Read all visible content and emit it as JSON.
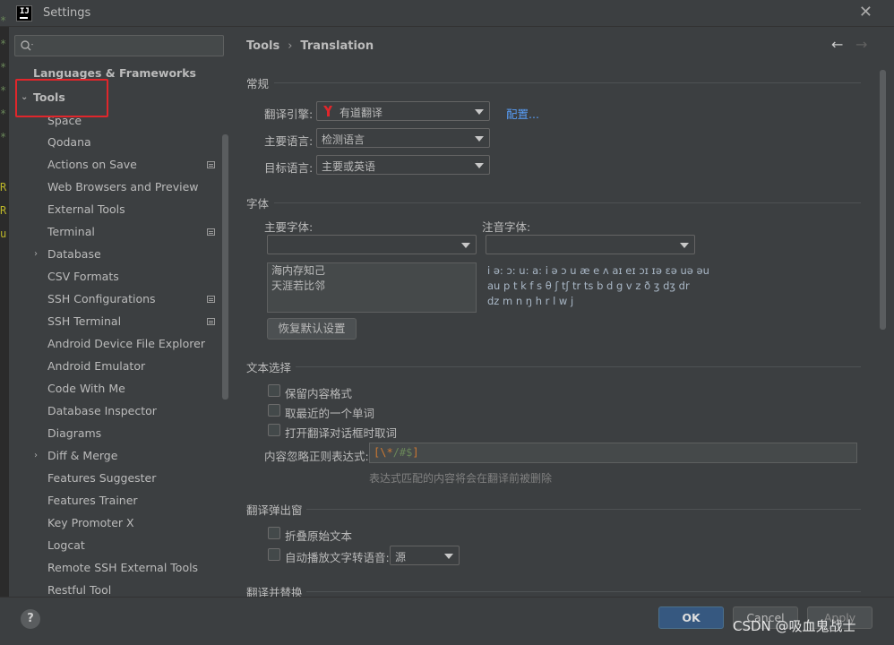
{
  "window": {
    "title": "Settings",
    "app_icon_text": "IJ"
  },
  "sidebar": {
    "search_placeholder": "",
    "items": [
      {
        "label": "Languages & Frameworks",
        "level": 0,
        "bold": true
      },
      {
        "label": "Tools",
        "level": 0,
        "bold": true,
        "expanded": true
      },
      {
        "label": "Space",
        "level": 1
      },
      {
        "label": "Qodana",
        "level": 1
      },
      {
        "label": "Actions on Save",
        "level": 1,
        "icon": true
      },
      {
        "label": "Web Browsers and Preview",
        "level": 1
      },
      {
        "label": "External Tools",
        "level": 1
      },
      {
        "label": "Terminal",
        "level": 1,
        "icon": true
      },
      {
        "label": "Database",
        "level": 1,
        "collapsed": true
      },
      {
        "label": "CSV Formats",
        "level": 1
      },
      {
        "label": "SSH Configurations",
        "level": 1,
        "icon": true
      },
      {
        "label": "SSH Terminal",
        "level": 1,
        "icon": true
      },
      {
        "label": "Android Device File Explorer",
        "level": 1
      },
      {
        "label": "Android Emulator",
        "level": 1
      },
      {
        "label": "Code With Me",
        "level": 1
      },
      {
        "label": "Database Inspector",
        "level": 1
      },
      {
        "label": "Diagrams",
        "level": 1
      },
      {
        "label": "Diff & Merge",
        "level": 1,
        "collapsed": true
      },
      {
        "label": "Features Suggester",
        "level": 1
      },
      {
        "label": "Features Trainer",
        "level": 1
      },
      {
        "label": "Key Promoter X",
        "level": 1
      },
      {
        "label": "Logcat",
        "level": 1
      },
      {
        "label": "Remote SSH External Tools",
        "level": 1
      },
      {
        "label": "Restful Tool",
        "level": 1
      }
    ]
  },
  "breadcrumb": {
    "parent": "Tools",
    "sep": "›",
    "current": "Translation"
  },
  "general": {
    "title": "常规",
    "engine_label": "翻译引擎:",
    "engine_value": "有道翻译",
    "configure_link": "配置...",
    "primary_lang_label": "主要语言:",
    "primary_lang_value": "检测语言",
    "target_lang_label": "目标语言:",
    "target_lang_value": "主要或英语"
  },
  "font": {
    "title": "字体",
    "primary_font_label": "主要字体:",
    "primary_font_value": "",
    "phonetic_font_label": "注音字体:",
    "phonetic_font_value": "",
    "preview_line1": "海内存知己",
    "preview_line2": "天涯若比邻",
    "phonetic_line1": "i ə: ɔ: u: a: i ə ɔ u æ e ʌ aɪ eɪ ɔɪ ɪə ɛə uə əu",
    "phonetic_line2": "au p t k f s θ ʃ tʃ tr ts b d g v z ð ʒ dʒ dr",
    "phonetic_line3": "dz m n ŋ h r l w j",
    "reset_button": "恢复默认设置"
  },
  "selection": {
    "title": "文本选择",
    "keep_format": "保留内容格式",
    "nearest_word": "取最近的一个单词",
    "cancel_on_open": "打开翻译对话框时取词",
    "regex_label": "内容忽略正则表达式:",
    "regex_bracket_open": "[",
    "regex_escape": "\\*",
    "regex_rest": "/#$",
    "regex_bracket_close": "]",
    "regex_hint": "表达式匹配的内容将会在翻译前被删除"
  },
  "popup": {
    "title": "翻译弹出窗",
    "fold_original": "折叠原始文本",
    "autoplay_tts": "自动播放文字转语音:",
    "autoplay_value": "源"
  },
  "replace": {
    "title": "翻译并替换"
  },
  "footer": {
    "help": "?",
    "ok": "OK",
    "cancel": "Cancel",
    "apply": "Apply"
  },
  "watermark": "CSDN @吸血鬼战士",
  "colors": {
    "accent": "#365880",
    "link": "#589df6",
    "highlight_box": "#e0262b",
    "youdao_red": "#e0262b"
  }
}
